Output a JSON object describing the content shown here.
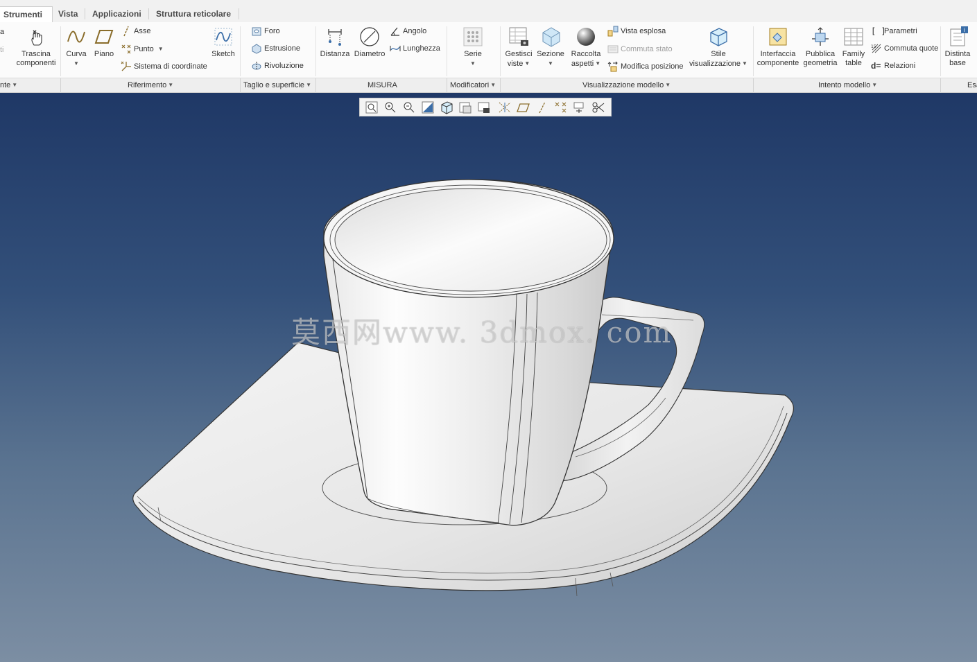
{
  "tabs": [
    {
      "label": "Strumenti",
      "active": true
    },
    {
      "label": "Vista",
      "active": false
    },
    {
      "label": "Applicazioni",
      "active": false
    },
    {
      "label": "Struttura reticolare",
      "active": false
    }
  ],
  "ribbon": {
    "left_fragments": {
      "top": "a",
      "mid": "ti"
    },
    "drag": {
      "label": "Trascina componenti",
      "icon": "drag-hand-icon"
    },
    "curva": {
      "label": "Curva",
      "icon": "curve-icon"
    },
    "piano": {
      "label": "Piano",
      "icon": "plane-icon"
    },
    "asse": {
      "label": "Asse",
      "icon": "axis-icon"
    },
    "punto": {
      "label": "Punto",
      "icon": "point-icon"
    },
    "sistema": {
      "label": "Sistema di coordinate",
      "icon": "coordinate-system-icon"
    },
    "sketch": {
      "label": "Sketch",
      "icon": "sketch-icon"
    },
    "foro": {
      "label": "Foro",
      "icon": "hole-icon"
    },
    "estrusione": {
      "label": "Estrusione",
      "icon": "extrude-icon"
    },
    "rivoluzione": {
      "label": "Rivoluzione",
      "icon": "revolve-icon"
    },
    "distanza": {
      "label": "Distanza",
      "icon": "distance-icon"
    },
    "diametro": {
      "label": "Diametro",
      "icon": "diameter-icon"
    },
    "angolo": {
      "label": "Angolo",
      "icon": "angle-icon"
    },
    "lunghezza": {
      "label": "Lunghezza",
      "icon": "length-icon"
    },
    "serie": {
      "label": "Serie",
      "icon": "pattern-icon"
    },
    "gestisci": {
      "label": "Gestisci viste",
      "icon": "manage-views-icon"
    },
    "sezione": {
      "label": "Sezione",
      "icon": "section-icon"
    },
    "raccolta": {
      "label": "Raccolta aspetti",
      "icon": "appearance-sphere-icon"
    },
    "vista_esplosa": {
      "label": "Vista esplosa",
      "icon": "exploded-view-icon"
    },
    "commuta_stato": {
      "label": "Commuta stato",
      "icon": "toggle-state-icon",
      "disabled": true
    },
    "modifica_posizione": {
      "label": "Modifica posizione",
      "icon": "edit-position-icon"
    },
    "stile": {
      "label": "Stile visualizzazione",
      "icon": "display-style-icon"
    },
    "interfaccia": {
      "label": "Interfaccia componente",
      "icon": "component-interface-icon"
    },
    "pubblica": {
      "label": "Pubblica geometria",
      "icon": "publish-geometry-icon"
    },
    "family": {
      "label": "Family table",
      "icon": "family-table-icon"
    },
    "parametri": {
      "label": "Parametri",
      "icon": "parameters-icon"
    },
    "commuta_quote": {
      "label": "Commuta quote",
      "icon": "toggle-dimensions-icon"
    },
    "relazioni": {
      "label": "Relazioni",
      "icon": "relations-icon"
    },
    "distinta": {
      "label": "Distinta base",
      "icon": "bill-of-materials-icon"
    }
  },
  "groups": [
    {
      "label": "nte",
      "caret": true
    },
    {
      "label": "Riferimento",
      "caret": true
    },
    {
      "label": "Taglio e superficie",
      "caret": true
    },
    {
      "label": "MISURA",
      "caret": false
    },
    {
      "label": "Modificatori",
      "caret": true
    },
    {
      "label": "Visualizzazione modello",
      "caret": true
    },
    {
      "label": "Intento modello",
      "caret": true
    },
    {
      "label": "Esa",
      "caret": false
    }
  ],
  "view_toolbar": [
    "refit-icon",
    "zoom-in-icon",
    "zoom-out-icon",
    "repaint-icon",
    "display-style-icon",
    "saved-views-icon",
    "view-manager-icon",
    "datum-display-icon",
    "plane-display-icon",
    "axis-display-icon",
    "point-display-icon",
    "csys-display-icon",
    "annotation-display-icon"
  ],
  "viewport": {
    "watermark": "莫西网www. 3dmox. com",
    "model": "cup-and-saucer",
    "background_top": "#1f3866",
    "background_bottom": "#7c8ea3"
  }
}
